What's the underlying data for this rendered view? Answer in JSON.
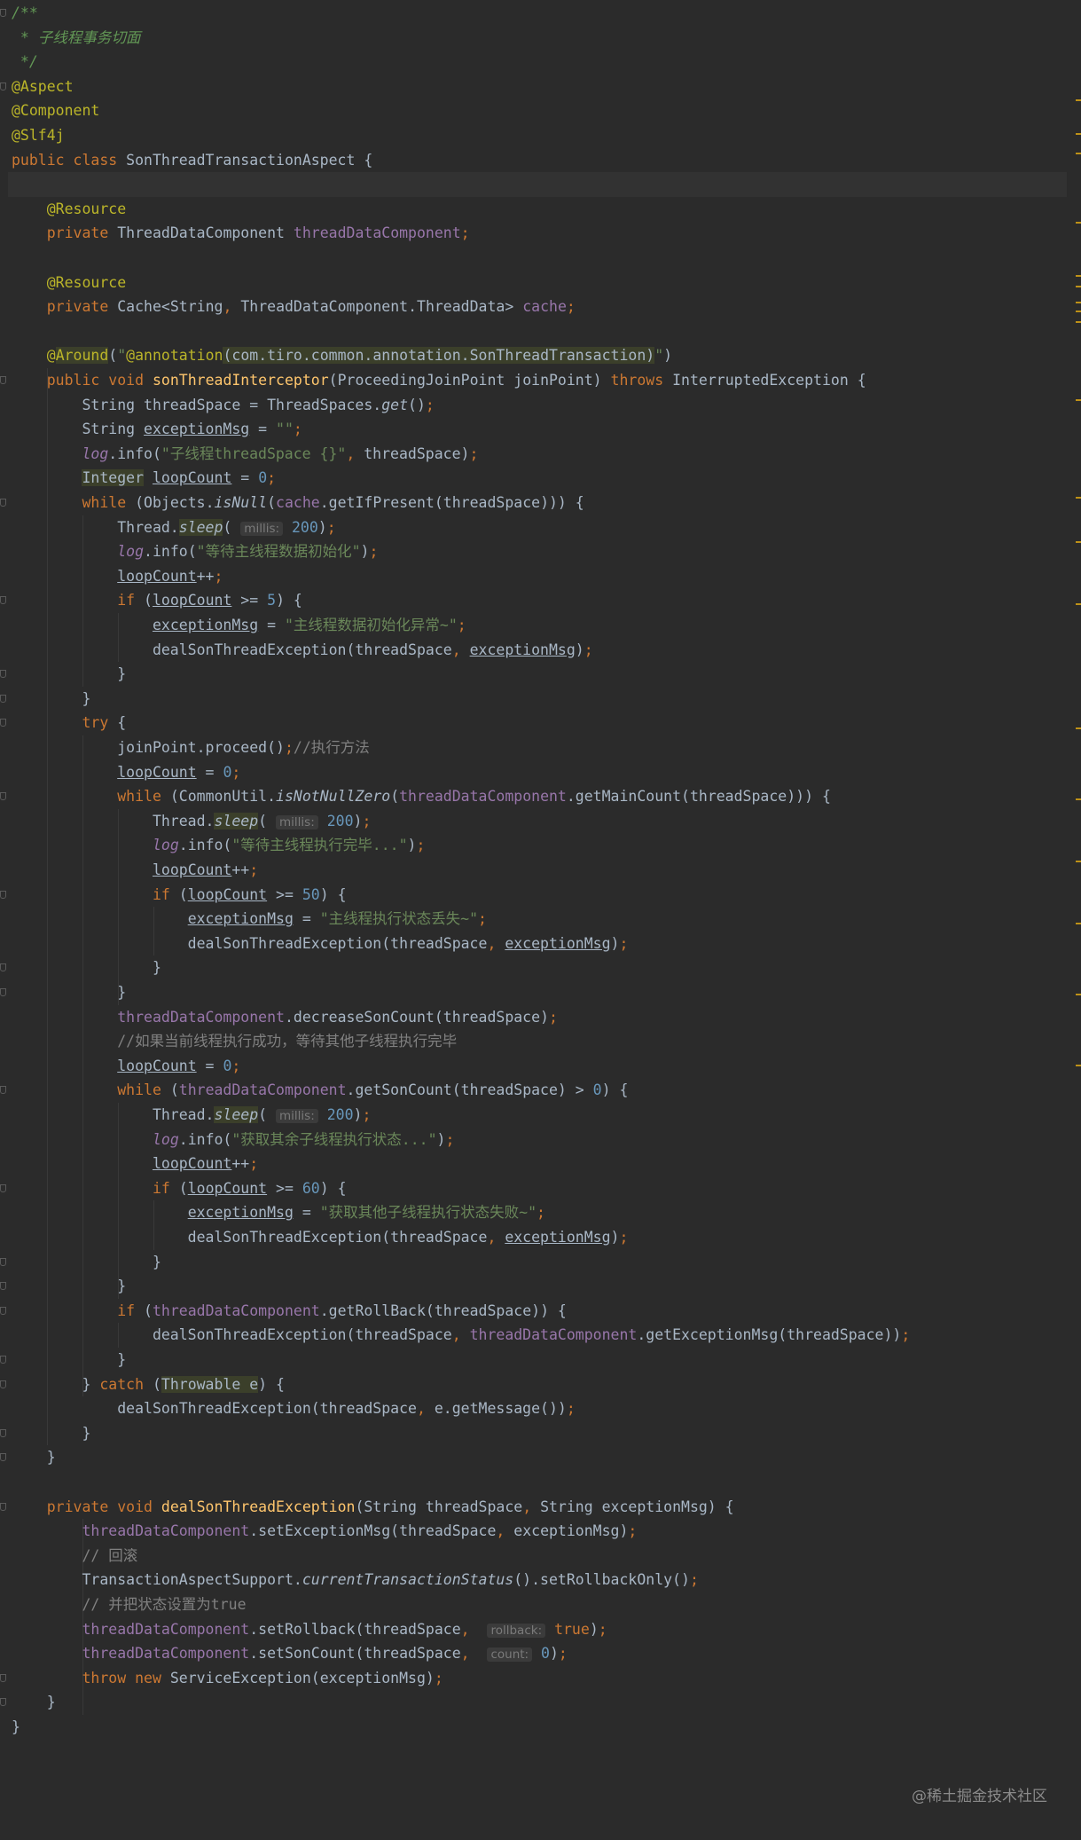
{
  "lines": [
    [
      {
        "t": "/**",
        "c": "doc"
      }
    ],
    [
      {
        "t": " * ",
        "c": "doc"
      },
      {
        "t": "子线程事务切面",
        "c": "doc"
      }
    ],
    [
      {
        "t": " */",
        "c": "doc"
      }
    ],
    [
      {
        "t": "@Aspect",
        "c": "ann"
      }
    ],
    [
      {
        "t": "@Component",
        "c": "ann"
      }
    ],
    [
      {
        "t": "@Slf4j",
        "c": "ann"
      }
    ],
    [
      {
        "t": "public class ",
        "c": "kw"
      },
      {
        "t": "SonThreadTransactionAspect {",
        "c": "default"
      }
    ],
    [],
    [
      {
        "t": "    "
      },
      {
        "t": "@Resource",
        "c": "ann"
      }
    ],
    [
      {
        "t": "    "
      },
      {
        "t": "private ",
        "c": "kw"
      },
      {
        "t": "ThreadDataComponent "
      },
      {
        "t": "threadDataComponent",
        "c": "field"
      },
      {
        "t": ";",
        "c": "kw"
      }
    ],
    [],
    [
      {
        "t": "    "
      },
      {
        "t": "@Resource",
        "c": "ann"
      }
    ],
    [
      {
        "t": "    "
      },
      {
        "t": "private ",
        "c": "kw"
      },
      {
        "t": "Cache<String"
      },
      {
        "t": ", ",
        "c": "kw"
      },
      {
        "t": "ThreadDataComponent.ThreadData> "
      },
      {
        "t": "cache",
        "c": "field"
      },
      {
        "t": ";",
        "c": "kw"
      }
    ],
    [],
    [
      {
        "t": "    "
      },
      {
        "t": "@",
        "c": "ann"
      },
      {
        "t": "Around",
        "c": "ann hl"
      },
      {
        "t": "("
      },
      {
        "t": "\"",
        "c": "str"
      },
      {
        "t": "@annotation",
        "c": "ann"
      },
      {
        "t": "(com.tiro.common.annotation.SonThreadTransaction)",
        "c": "default hl"
      },
      {
        "t": "\"",
        "c": "str"
      },
      {
        "t": ")"
      }
    ],
    [
      {
        "t": "    "
      },
      {
        "t": "public void ",
        "c": "kw"
      },
      {
        "t": "sonThreadInterceptor",
        "c": "method"
      },
      {
        "t": "(ProceedingJoinPoint joinPoint) "
      },
      {
        "t": "throws ",
        "c": "kw"
      },
      {
        "t": "InterruptedException {"
      }
    ],
    [
      {
        "t": "        String threadSpace = ThreadSpaces."
      },
      {
        "t": "get",
        "c": "italic"
      },
      {
        "t": "()"
      },
      {
        "t": ";",
        "c": "kw"
      }
    ],
    [
      {
        "t": "        String "
      },
      {
        "t": "exceptionMsg",
        "c": "under"
      },
      {
        "t": " = "
      },
      {
        "t": "\"\"",
        "c": "str"
      },
      {
        "t": ";",
        "c": "kw"
      }
    ],
    [
      {
        "t": "        "
      },
      {
        "t": "log",
        "c": "static"
      },
      {
        "t": ".info("
      },
      {
        "t": "\"子线程threadSpace {}\"",
        "c": "str"
      },
      {
        "t": ", ",
        "c": "kw"
      },
      {
        "t": "threadSpace)"
      },
      {
        "t": ";",
        "c": "kw"
      }
    ],
    [
      {
        "t": "        "
      },
      {
        "t": "Integer",
        "c": "default hl"
      },
      {
        "t": " "
      },
      {
        "t": "loopCount",
        "c": "under"
      },
      {
        "t": " = "
      },
      {
        "t": "0",
        "c": "num"
      },
      {
        "t": ";",
        "c": "kw"
      }
    ],
    [
      {
        "t": "        "
      },
      {
        "t": "while ",
        "c": "kw"
      },
      {
        "t": "(Objects."
      },
      {
        "t": "isNull",
        "c": "italic"
      },
      {
        "t": "("
      },
      {
        "t": "cache",
        "c": "field"
      },
      {
        "t": ".getIfPresent(threadSpace))) {"
      }
    ],
    [
      {
        "t": "            Thread."
      },
      {
        "t": "sleep",
        "c": "italic hl"
      },
      {
        "t": "( "
      },
      {
        "t": "millis:",
        "c": "hint"
      },
      {
        "t": " "
      },
      {
        "t": "200",
        "c": "num"
      },
      {
        "t": ")"
      },
      {
        "t": ";",
        "c": "kw"
      }
    ],
    [
      {
        "t": "            "
      },
      {
        "t": "log",
        "c": "static"
      },
      {
        "t": ".info("
      },
      {
        "t": "\"等待主线程数据初始化\"",
        "c": "str"
      },
      {
        "t": ")"
      },
      {
        "t": ";",
        "c": "kw"
      }
    ],
    [
      {
        "t": "            "
      },
      {
        "t": "loopCount",
        "c": "under"
      },
      {
        "t": "++"
      },
      {
        "t": ";",
        "c": "kw"
      }
    ],
    [
      {
        "t": "            "
      },
      {
        "t": "if ",
        "c": "kw"
      },
      {
        "t": "("
      },
      {
        "t": "loopCount",
        "c": "under"
      },
      {
        "t": " >= "
      },
      {
        "t": "5",
        "c": "num"
      },
      {
        "t": ") {"
      }
    ],
    [
      {
        "t": "                "
      },
      {
        "t": "exceptionMsg",
        "c": "under"
      },
      {
        "t": " = "
      },
      {
        "t": "\"主线程数据初始化异常~\"",
        "c": "str"
      },
      {
        "t": ";",
        "c": "kw"
      }
    ],
    [
      {
        "t": "                dealSonThreadException(threadSpace"
      },
      {
        "t": ", ",
        "c": "kw"
      },
      {
        "t": "exceptionMsg",
        "c": "under"
      },
      {
        "t": ")"
      },
      {
        "t": ";",
        "c": "kw"
      }
    ],
    [
      {
        "t": "            }"
      }
    ],
    [
      {
        "t": "        }"
      }
    ],
    [
      {
        "t": "        "
      },
      {
        "t": "try ",
        "c": "kw"
      },
      {
        "t": "{"
      }
    ],
    [
      {
        "t": "            joinPoint.proceed()"
      },
      {
        "t": ";",
        "c": "kw"
      },
      {
        "t": "//执行方法",
        "c": "comment"
      }
    ],
    [
      {
        "t": "            "
      },
      {
        "t": "loopCount",
        "c": "under"
      },
      {
        "t": " = "
      },
      {
        "t": "0",
        "c": "num"
      },
      {
        "t": ";",
        "c": "kw"
      }
    ],
    [
      {
        "t": "            "
      },
      {
        "t": "while ",
        "c": "kw"
      },
      {
        "t": "(CommonUtil."
      },
      {
        "t": "isNotNullZero",
        "c": "italic"
      },
      {
        "t": "("
      },
      {
        "t": "threadDataComponent",
        "c": "field"
      },
      {
        "t": ".getMainCount(threadSpace))) {"
      }
    ],
    [
      {
        "t": "                Thread."
      },
      {
        "t": "sleep",
        "c": "italic hl"
      },
      {
        "t": "( "
      },
      {
        "t": "millis:",
        "c": "hint"
      },
      {
        "t": " "
      },
      {
        "t": "200",
        "c": "num"
      },
      {
        "t": ")"
      },
      {
        "t": ";",
        "c": "kw"
      }
    ],
    [
      {
        "t": "                "
      },
      {
        "t": "log",
        "c": "static"
      },
      {
        "t": ".info("
      },
      {
        "t": "\"等待主线程执行完毕...\"",
        "c": "str"
      },
      {
        "t": ")"
      },
      {
        "t": ";",
        "c": "kw"
      }
    ],
    [
      {
        "t": "                "
      },
      {
        "t": "loopCount",
        "c": "under"
      },
      {
        "t": "++"
      },
      {
        "t": ";",
        "c": "kw"
      }
    ],
    [
      {
        "t": "                "
      },
      {
        "t": "if ",
        "c": "kw"
      },
      {
        "t": "("
      },
      {
        "t": "loopCount",
        "c": "under"
      },
      {
        "t": " >= "
      },
      {
        "t": "50",
        "c": "num"
      },
      {
        "t": ") {"
      }
    ],
    [
      {
        "t": "                    "
      },
      {
        "t": "exceptionMsg",
        "c": "under"
      },
      {
        "t": " = "
      },
      {
        "t": "\"主线程执行状态丢失~\"",
        "c": "str"
      },
      {
        "t": ";",
        "c": "kw"
      }
    ],
    [
      {
        "t": "                    dealSonThreadException(threadSpace"
      },
      {
        "t": ", ",
        "c": "kw"
      },
      {
        "t": "exceptionMsg",
        "c": "under"
      },
      {
        "t": ")"
      },
      {
        "t": ";",
        "c": "kw"
      }
    ],
    [
      {
        "t": "                }"
      }
    ],
    [
      {
        "t": "            }"
      }
    ],
    [
      {
        "t": "            "
      },
      {
        "t": "threadDataComponent",
        "c": "field"
      },
      {
        "t": ".decreaseSonCount(threadSpace)"
      },
      {
        "t": ";",
        "c": "kw"
      }
    ],
    [
      {
        "t": "            "
      },
      {
        "t": "//如果当前线程执行成功，等待其他子线程执行完毕",
        "c": "comment"
      }
    ],
    [
      {
        "t": "            "
      },
      {
        "t": "loopCount",
        "c": "under"
      },
      {
        "t": " = "
      },
      {
        "t": "0",
        "c": "num"
      },
      {
        "t": ";",
        "c": "kw"
      }
    ],
    [
      {
        "t": "            "
      },
      {
        "t": "while ",
        "c": "kw"
      },
      {
        "t": "("
      },
      {
        "t": "threadDataComponent",
        "c": "field"
      },
      {
        "t": ".getSonCount(threadSpace) > "
      },
      {
        "t": "0",
        "c": "num"
      },
      {
        "t": ") {"
      }
    ],
    [
      {
        "t": "                Thread."
      },
      {
        "t": "sleep",
        "c": "italic hl"
      },
      {
        "t": "( "
      },
      {
        "t": "millis:",
        "c": "hint"
      },
      {
        "t": " "
      },
      {
        "t": "200",
        "c": "num"
      },
      {
        "t": ")"
      },
      {
        "t": ";",
        "c": "kw"
      }
    ],
    [
      {
        "t": "                "
      },
      {
        "t": "log",
        "c": "static"
      },
      {
        "t": ".info("
      },
      {
        "t": "\"获取其余子线程执行状态...\"",
        "c": "str"
      },
      {
        "t": ")"
      },
      {
        "t": ";",
        "c": "kw"
      }
    ],
    [
      {
        "t": "                "
      },
      {
        "t": "loopCount",
        "c": "under"
      },
      {
        "t": "++"
      },
      {
        "t": ";",
        "c": "kw"
      }
    ],
    [
      {
        "t": "                "
      },
      {
        "t": "if ",
        "c": "kw"
      },
      {
        "t": "("
      },
      {
        "t": "loopCount",
        "c": "under"
      },
      {
        "t": " >= "
      },
      {
        "t": "60",
        "c": "num"
      },
      {
        "t": ") {"
      }
    ],
    [
      {
        "t": "                    "
      },
      {
        "t": "exceptionMsg",
        "c": "under"
      },
      {
        "t": " = "
      },
      {
        "t": "\"获取其他子线程执行状态失败~\"",
        "c": "str"
      },
      {
        "t": ";",
        "c": "kw"
      }
    ],
    [
      {
        "t": "                    dealSonThreadException(threadSpace"
      },
      {
        "t": ", ",
        "c": "kw"
      },
      {
        "t": "exceptionMsg",
        "c": "under"
      },
      {
        "t": ")"
      },
      {
        "t": ";",
        "c": "kw"
      }
    ],
    [
      {
        "t": "                }"
      }
    ],
    [
      {
        "t": "            }"
      }
    ],
    [
      {
        "t": "            "
      },
      {
        "t": "if ",
        "c": "kw"
      },
      {
        "t": "("
      },
      {
        "t": "threadDataComponent",
        "c": "field"
      },
      {
        "t": ".getRollBack(threadSpace)) {"
      }
    ],
    [
      {
        "t": "                dealSonThreadException(threadSpace"
      },
      {
        "t": ", ",
        "c": "kw"
      },
      {
        "t": "threadDataComponent",
        "c": "field"
      },
      {
        "t": ".getExceptionMsg(threadSpace))"
      },
      {
        "t": ";",
        "c": "kw"
      }
    ],
    [
      {
        "t": "            }"
      }
    ],
    [
      {
        "t": "        } "
      },
      {
        "t": "catch ",
        "c": "kw"
      },
      {
        "t": "("
      },
      {
        "t": "Throwable e",
        "c": "default hl"
      },
      {
        "t": ") {"
      }
    ],
    [
      {
        "t": "            dealSonThreadException(threadSpace"
      },
      {
        "t": ", ",
        "c": "kw"
      },
      {
        "t": "e.getMessage())"
      },
      {
        "t": ";",
        "c": "kw"
      }
    ],
    [
      {
        "t": "        }"
      }
    ],
    [
      {
        "t": "    }"
      }
    ],
    [],
    [
      {
        "t": "    "
      },
      {
        "t": "private void ",
        "c": "kw"
      },
      {
        "t": "dealSonThreadException",
        "c": "method"
      },
      {
        "t": "(String threadSpace"
      },
      {
        "t": ", ",
        "c": "kw"
      },
      {
        "t": "String exceptionMsg) {"
      }
    ],
    [
      {
        "t": "        "
      },
      {
        "t": "threadDataComponent",
        "c": "field"
      },
      {
        "t": ".setExceptionMsg(threadSpace"
      },
      {
        "t": ", ",
        "c": "kw"
      },
      {
        "t": "exceptionMsg)"
      },
      {
        "t": ";",
        "c": "kw"
      }
    ],
    [
      {
        "t": "        "
      },
      {
        "t": "// 回滚",
        "c": "comment"
      }
    ],
    [
      {
        "t": "        TransactionAspectSupport."
      },
      {
        "t": "currentTransactionStatus",
        "c": "italic"
      },
      {
        "t": "().setRollbackOnly()"
      },
      {
        "t": ";",
        "c": "kw"
      }
    ],
    [
      {
        "t": "        "
      },
      {
        "t": "// 并把状态设置为true",
        "c": "comment"
      }
    ],
    [
      {
        "t": "        "
      },
      {
        "t": "threadDataComponent",
        "c": "field"
      },
      {
        "t": ".setRollback(threadSpace"
      },
      {
        "t": ", ",
        "c": "kw"
      },
      {
        "t": " "
      },
      {
        "t": "rollback:",
        "c": "hint"
      },
      {
        "t": " "
      },
      {
        "t": "true",
        "c": "kw"
      },
      {
        "t": ")"
      },
      {
        "t": ";",
        "c": "kw"
      }
    ],
    [
      {
        "t": "        "
      },
      {
        "t": "threadDataComponent",
        "c": "field"
      },
      {
        "t": ".setSonCount(threadSpace"
      },
      {
        "t": ", ",
        "c": "kw"
      },
      {
        "t": " "
      },
      {
        "t": "count:",
        "c": "hint"
      },
      {
        "t": " "
      },
      {
        "t": "0",
        "c": "num"
      },
      {
        "t": ")"
      },
      {
        "t": ";",
        "c": "kw"
      }
    ],
    [
      {
        "t": "        "
      },
      {
        "t": "throw new ",
        "c": "kw"
      },
      {
        "t": "ServiceException(exceptionMsg)"
      },
      {
        "t": ";",
        "c": "kw"
      }
    ],
    [
      {
        "t": "    }"
      }
    ],
    [
      {
        "t": "}"
      }
    ]
  ],
  "current_line": 7,
  "watermark": "@稀土掘金技术社区",
  "colors": {
    "background": "#2b2b2b",
    "keyword": "#cc7832",
    "annotation": "#bbb529",
    "string": "#6a8759",
    "number": "#6897bb",
    "field": "#9876aa",
    "method": "#ffc66d",
    "comment": "#808080",
    "doc": "#629755",
    "default": "#a9b7c6"
  }
}
